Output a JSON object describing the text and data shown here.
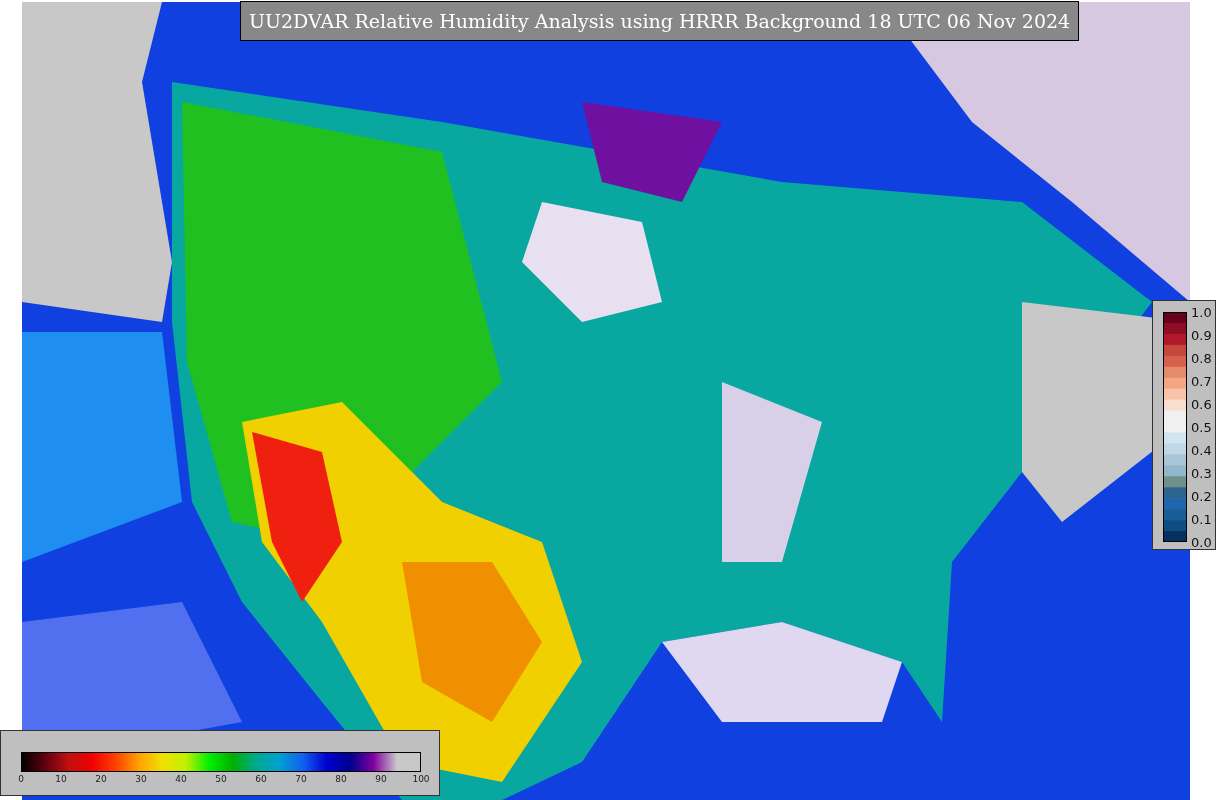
{
  "title": "UU2DVAR Relative Humidity Analysis using HRRR Background 18 UTC 06 Nov 2024",
  "colorbar_horizontal": {
    "ticks": [
      "0",
      "10",
      "20",
      "30",
      "40",
      "50",
      "60",
      "70",
      "80",
      "90",
      "100"
    ]
  },
  "colorbar_vertical": {
    "ticks": [
      "1.0",
      "0.9",
      "0.8",
      "0.7",
      "0.6",
      "0.5",
      "0.4",
      "0.3",
      "0.2",
      "0.1",
      "0.0"
    ]
  }
}
